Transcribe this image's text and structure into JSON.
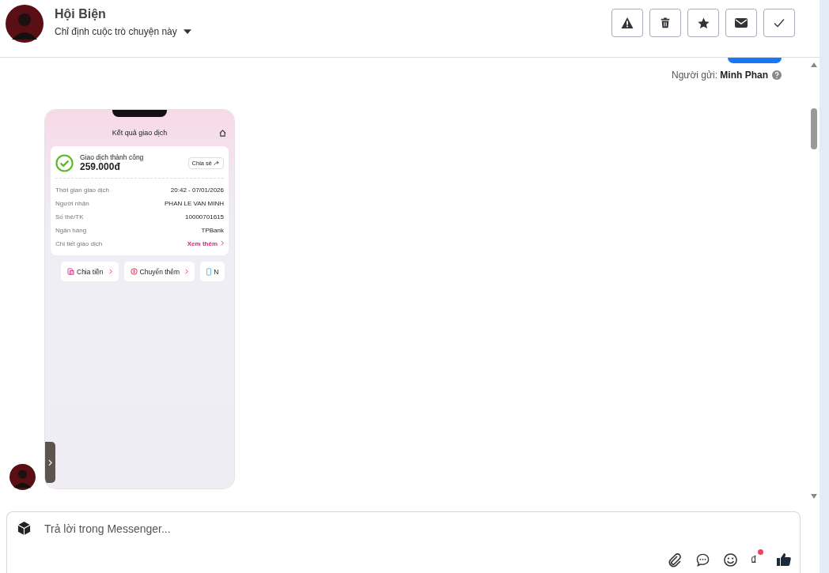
{
  "header": {
    "name": "Hội Biện",
    "assign_label": "Chỉ định cuộc trò chuyện này",
    "actions": [
      {
        "kind": "warning"
      },
      {
        "kind": "trash"
      },
      {
        "kind": "star"
      },
      {
        "kind": "mail"
      },
      {
        "kind": "check"
      }
    ]
  },
  "sender": {
    "label": "Người gửi:",
    "name": "Minh Phan"
  },
  "receipt": {
    "title": "Kết quả giao dịch",
    "status": "Giao dịch thành công",
    "amount": "259.000đ",
    "share": "Chia sẻ",
    "rows": [
      {
        "label": "Thời gian giao dịch",
        "value": "20:42 - 07/01/2026",
        "kind": "text"
      },
      {
        "label": "Người nhận",
        "value": "PHAN LE VAN MINH",
        "kind": "text"
      },
      {
        "label": "Số thẻ/TK",
        "value": "10000701615",
        "kind": "text"
      },
      {
        "label": "Ngân hàng",
        "value": "TPBank",
        "kind": "text"
      },
      {
        "label": "Chi tiết giao dịch",
        "value": "Xem thêm",
        "kind": "link"
      }
    ],
    "chips": [
      {
        "label": "Chia tiền",
        "kind": "split"
      },
      {
        "label": "Chuyển thêm",
        "kind": "money"
      },
      {
        "label": "N",
        "kind": "phone"
      }
    ]
  },
  "composer": {
    "placeholder": "Trả lời trong Messenger...",
    "currency": "₫"
  }
}
